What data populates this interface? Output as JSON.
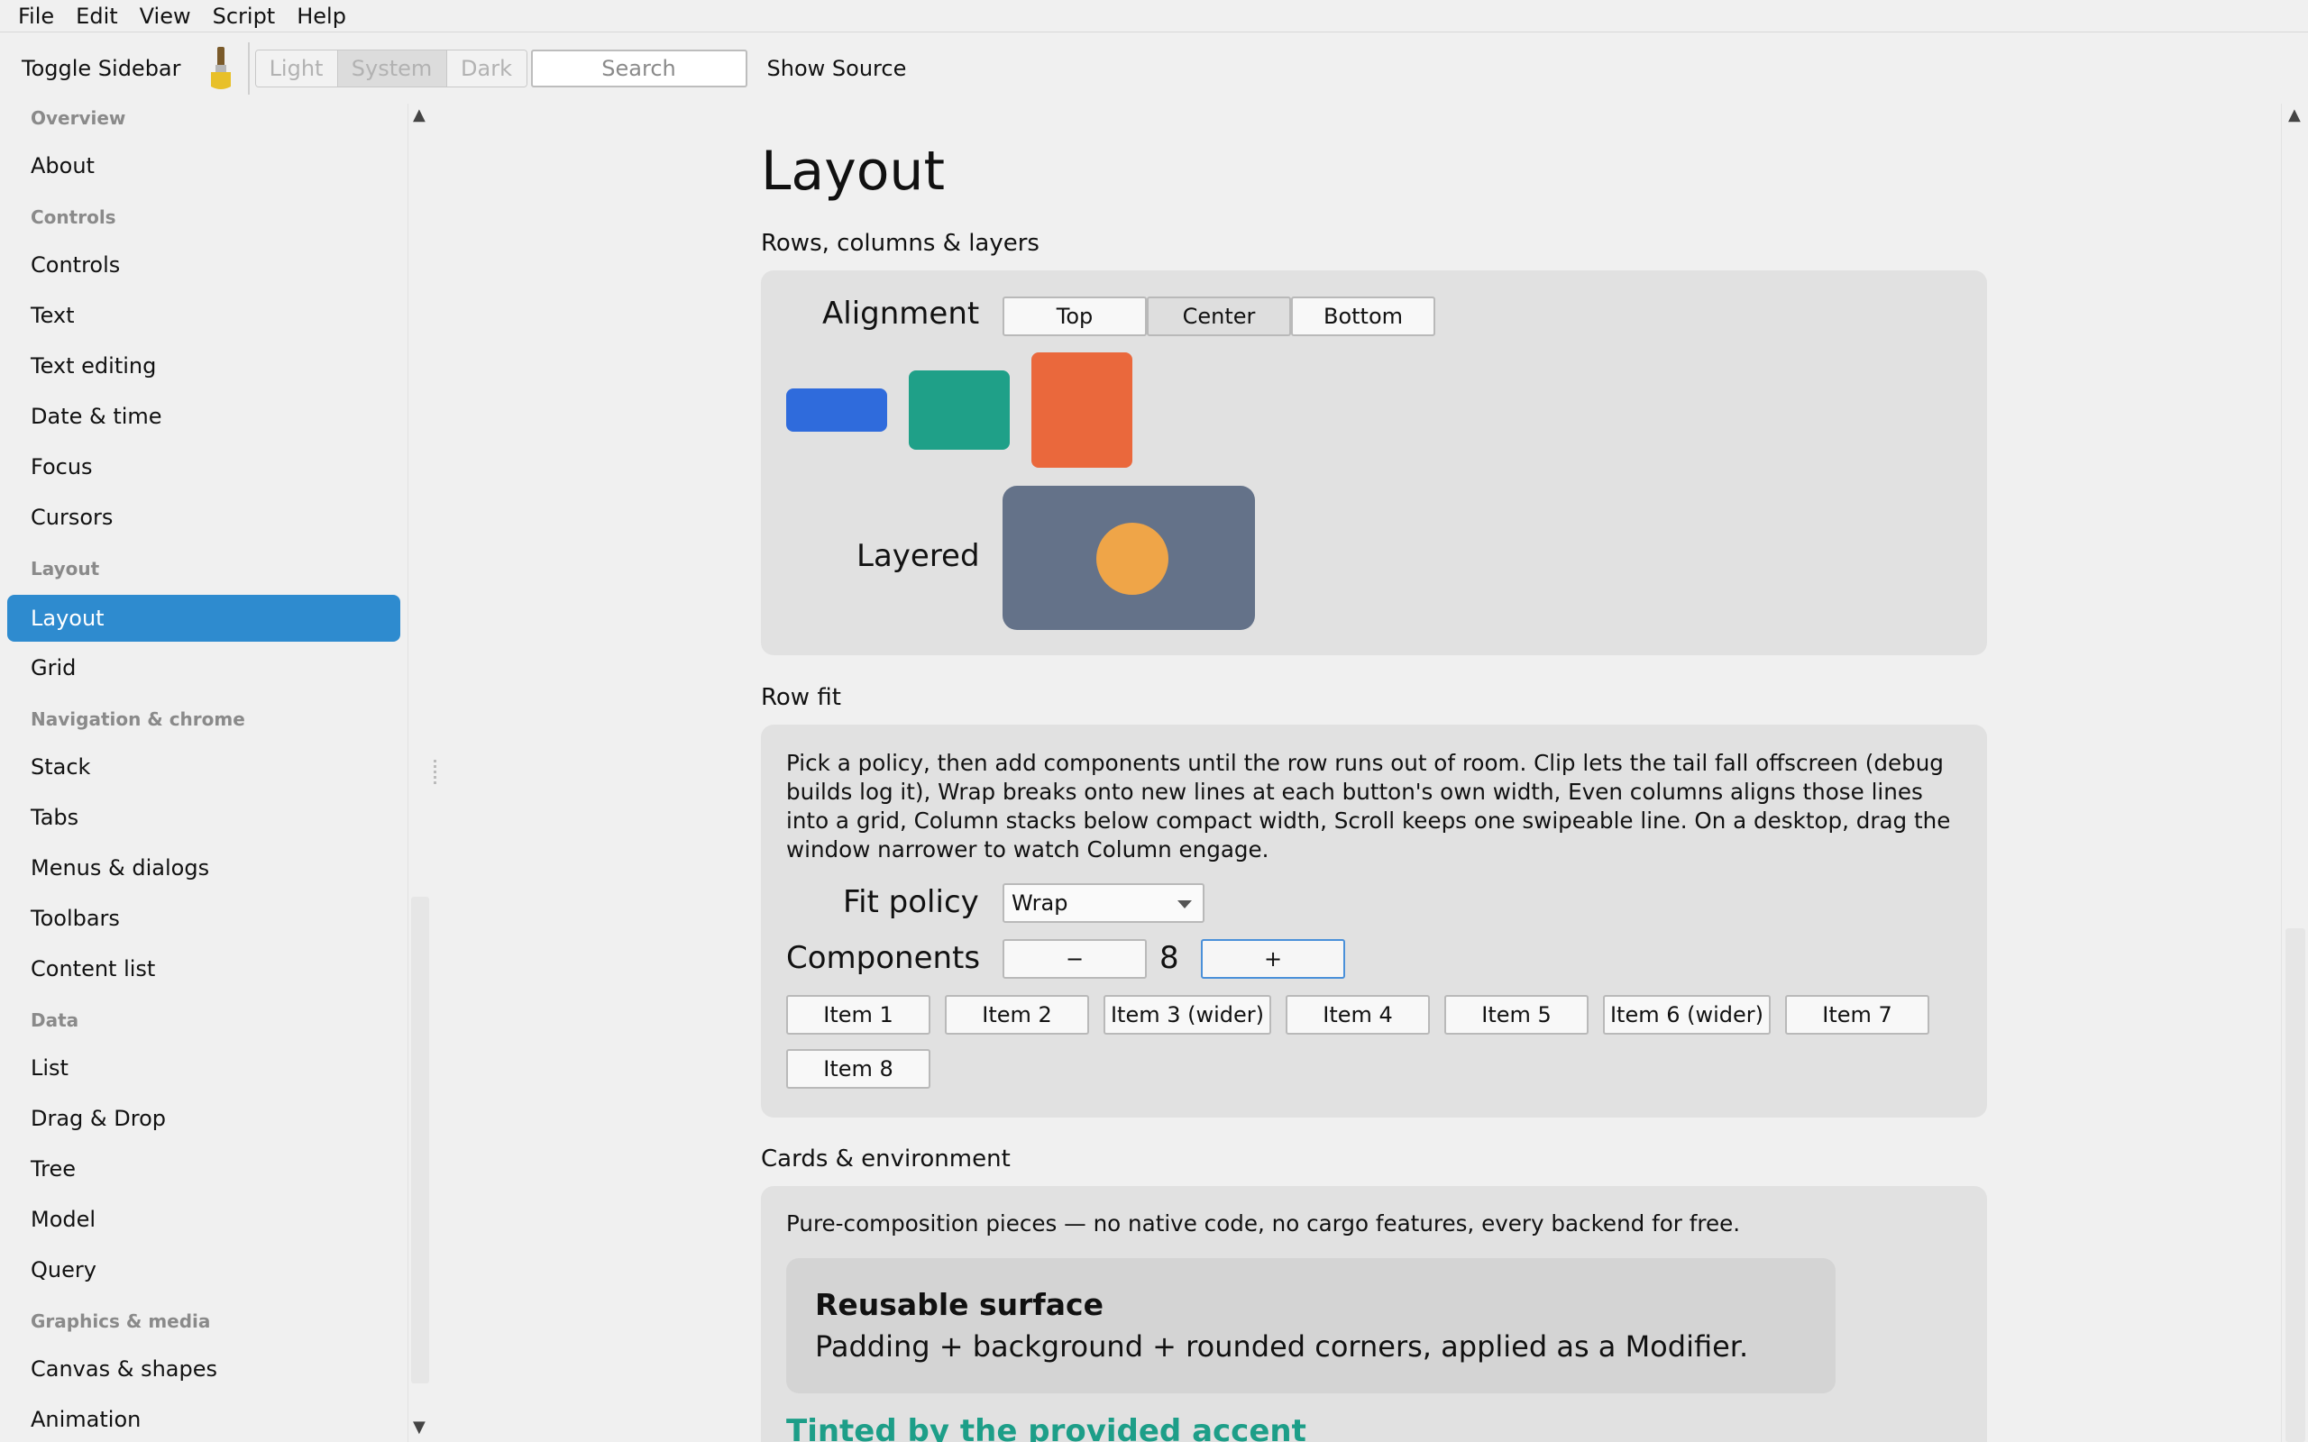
{
  "menubar": {
    "items": [
      "File",
      "Edit",
      "View",
      "Script",
      "Help"
    ]
  },
  "toolbar": {
    "toggle_sidebar": "Toggle Sidebar",
    "theme_icon": "paintbrush-icon",
    "theme_options": [
      "Light",
      "System",
      "Dark"
    ],
    "theme_selected": "System",
    "search_placeholder": "Search",
    "show_source": "Show Source"
  },
  "sidebar": {
    "sections": [
      {
        "title": "Overview",
        "items": [
          "About"
        ]
      },
      {
        "title": "Controls",
        "items": [
          "Controls",
          "Text",
          "Text editing",
          "Date & time",
          "Focus",
          "Cursors"
        ]
      },
      {
        "title": "Layout",
        "items": [
          "Layout",
          "Grid"
        ]
      },
      {
        "title": "Navigation & chrome",
        "items": [
          "Stack",
          "Tabs",
          "Menus & dialogs",
          "Toolbars",
          "Content list"
        ]
      },
      {
        "title": "Data",
        "items": [
          "List",
          "Drag & Drop",
          "Tree",
          "Model",
          "Query"
        ]
      },
      {
        "title": "Graphics & media",
        "items": [
          "Canvas & shapes",
          "Animation"
        ]
      }
    ],
    "active_item": "Layout"
  },
  "main": {
    "title": "Layout",
    "rows_section": {
      "heading": "Rows, columns & layers",
      "alignment_label": "Alignment",
      "alignment_options": [
        "Top",
        "Center",
        "Bottom"
      ],
      "alignment_selected": "Center",
      "swatch_colors": [
        "#2f6bdc",
        "#1fa088",
        "#ea683c"
      ],
      "layered_label": "Layered",
      "layered_colors": {
        "back": "#647289",
        "front": "#efa548"
      }
    },
    "rowfit_section": {
      "heading": "Row fit",
      "description": "Pick a policy, then add components until the row runs out of room. Clip lets the tail fall offscreen (debug builds log it), Wrap breaks onto new lines at each button's own width, Even columns aligns those lines into a grid, Column stacks below compact width, Scroll keeps one swipeable line. On a desktop, drag the window narrower to watch Column engage.",
      "fit_policy_label": "Fit policy",
      "fit_policy_value": "Wrap",
      "components_label": "Components",
      "minus_label": "−",
      "plus_label": "+",
      "components_count": "8",
      "items": [
        "Item 1",
        "Item 2",
        "Item 3 (wider)",
        "Item 4",
        "Item 5",
        "Item 6 (wider)",
        "Item 7",
        "Item 8"
      ]
    },
    "cards_section": {
      "heading": "Cards & environment",
      "description": "Pure-composition pieces — no native code, no cargo features, every backend for free.",
      "card_title": "Reusable surface",
      "card_body": "Padding + background + rounded corners, applied as a Modifier.",
      "tinted_text": "Tinted by the provided accent",
      "accent_color": "#1d9e88"
    }
  }
}
